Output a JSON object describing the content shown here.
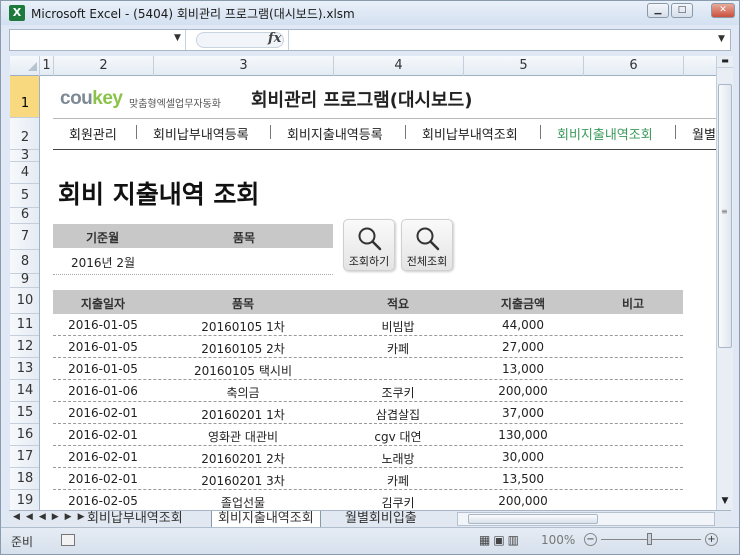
{
  "window": {
    "title": "Microsoft Excel - (5404) 회비관리 프로그램(대시보드).xlsm",
    "app_icon": "X"
  },
  "formula_bar": {
    "fx": "fx",
    "name_box": "",
    "formula": ""
  },
  "columns": [
    "1",
    "2",
    "3",
    "4",
    "5",
    "6"
  ],
  "rows": [
    "1",
    "2",
    "3",
    "4",
    "5",
    "6",
    "7",
    "8",
    "9",
    "10",
    "11",
    "12",
    "13",
    "14",
    "15",
    "16",
    "17",
    "18",
    "19"
  ],
  "selected_row": "1",
  "logo": {
    "part1": "cou",
    "part2": "key",
    "tagline": "맞춤형엑셀업무자동화"
  },
  "app_heading": "회비관리 프로그램(대시보드)",
  "nav": [
    {
      "label": "회원관리",
      "active": false
    },
    {
      "label": "회비납부내역등록",
      "active": false
    },
    {
      "label": "회비지출내역등록",
      "active": false
    },
    {
      "label": "회비납부내역조회",
      "active": false
    },
    {
      "label": "회비지출내역조회",
      "active": true
    },
    {
      "label": "월별",
      "active": false
    }
  ],
  "page_title": "회비 지출내역 조회",
  "filter": {
    "col1": "기준월",
    "col2": "품목",
    "month_value": "2016년 2월",
    "item_value": ""
  },
  "buttons": {
    "search": "조회하기",
    "search_all": "전체조회"
  },
  "table": {
    "headers": [
      "지출일자",
      "품목",
      "적요",
      "지출금액",
      "비고"
    ],
    "rows": [
      [
        "2016-01-05",
        "20160105 1차",
        "비빔밥",
        "44,000",
        ""
      ],
      [
        "2016-01-05",
        "20160105 2차",
        "카페",
        "27,000",
        ""
      ],
      [
        "2016-01-05",
        "20160105 택시비",
        "",
        "13,000",
        ""
      ],
      [
        "2016-01-06",
        "축의금",
        "조쿠키",
        "200,000",
        ""
      ],
      [
        "2016-02-01",
        "20160201 1차",
        "삼겹살집",
        "37,000",
        ""
      ],
      [
        "2016-02-01",
        "영화관 대관비",
        "cgv 대연",
        "130,000",
        ""
      ],
      [
        "2016-02-01",
        "20160201 2차",
        "노래방",
        "30,000",
        ""
      ],
      [
        "2016-02-01",
        "20160201 3차",
        "카페",
        "13,500",
        ""
      ],
      [
        "2016-02-05",
        "졸업선물",
        "김쿠키",
        "200,000",
        ""
      ]
    ]
  },
  "sheet_tabs": [
    {
      "label": "회비납부내역조회",
      "active": false
    },
    {
      "label": "회비지출내역조회",
      "active": true
    },
    {
      "label": "월별회비입출",
      "active": false
    }
  ],
  "tab_nav": "◀◀◀▶▶▶",
  "status": {
    "text": "준비",
    "zoom": "100%",
    "zoom_level": 1.0
  },
  "colors": {
    "active_nav": "#3a9a5a",
    "selected_row": "#f9d980",
    "logo_green": "#8bc34a"
  }
}
